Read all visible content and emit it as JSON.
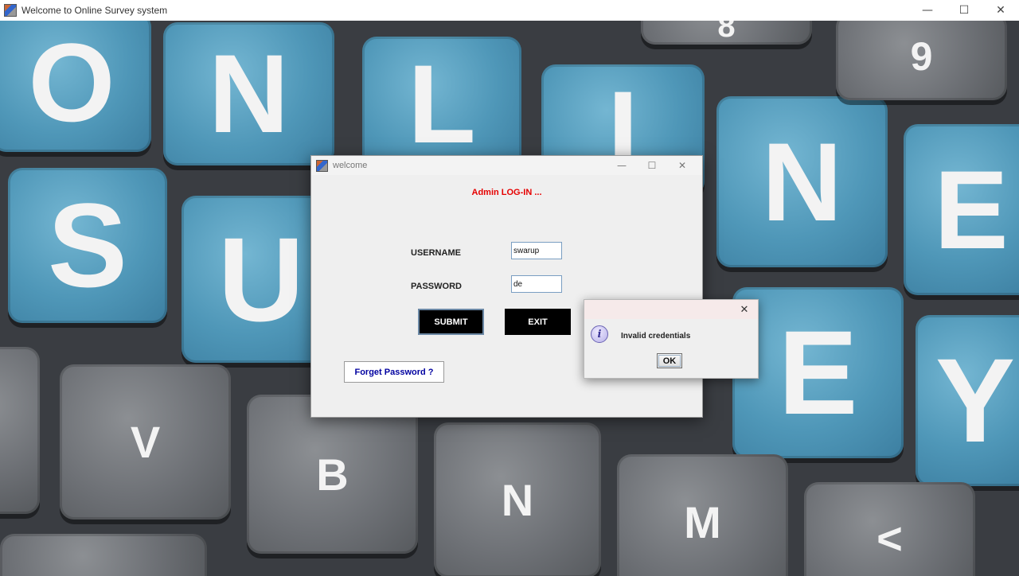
{
  "window": {
    "title": "Welcome to Online Survey system",
    "minimize": "—",
    "maximize": "☐",
    "close": "✕"
  },
  "background_keys": {
    "letters": [
      "O",
      "N",
      "L",
      "I",
      "N",
      "E",
      "S",
      "U",
      "E",
      "Y",
      "V",
      "B",
      "N",
      "M",
      "<",
      "8",
      "9"
    ]
  },
  "dialog": {
    "title": "welcome",
    "minimize": "—",
    "maximize": "☐",
    "close": "✕",
    "heading": "Admin LOG-IN ...",
    "username_label": "USERNAME",
    "username_value": "swarup",
    "password_label": "PASSWORD",
    "password_value": "de",
    "submit_label": "SUBMIT",
    "exit_label": "EXIT",
    "forget_label": "Forget Password ?"
  },
  "popup": {
    "close": "✕",
    "icon_glyph": "i",
    "message": "Invalid credentials",
    "ok_label": "OK"
  },
  "colors": {
    "heading": "#e60000",
    "link": "#0000a0",
    "key_blue": "#4f97b8",
    "key_gray": "#6e7176"
  }
}
